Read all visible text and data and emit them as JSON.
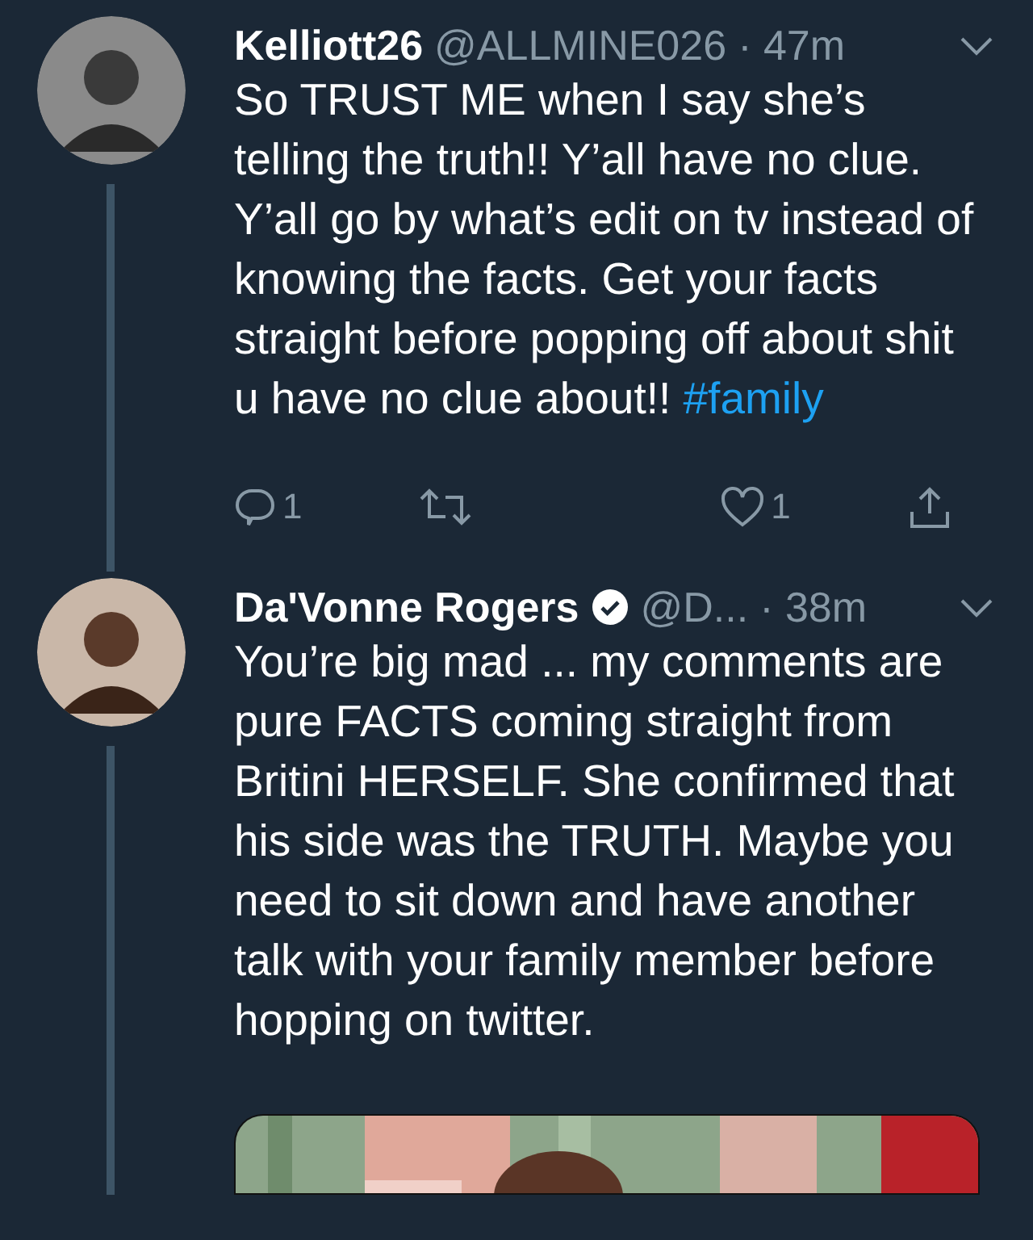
{
  "tweets": [
    {
      "name": "Kelliott26",
      "verified": false,
      "handle": "@ALLMINE026",
      "time": "· 47m",
      "text": "So TRUST ME when I say she’s telling the truth!! Y’all have no clue. Y’all go by what’s edit on tv instead of knowing the facts. Get your facts straight before popping off about shit u have no clue about!!",
      "hashtag": "#family",
      "actions": {
        "replies": "1",
        "likes": "1"
      }
    },
    {
      "name": "Da'Vonne Rogers",
      "verified": true,
      "handle": "@D...",
      "time": "· 38m",
      "text": "You’re big mad ... my comments are pure FACTS coming straight from Britini HERSELF. She confirmed that his side was the TRUTH. Maybe you need to sit down and have another talk with your family member before hopping on twitter."
    }
  ]
}
